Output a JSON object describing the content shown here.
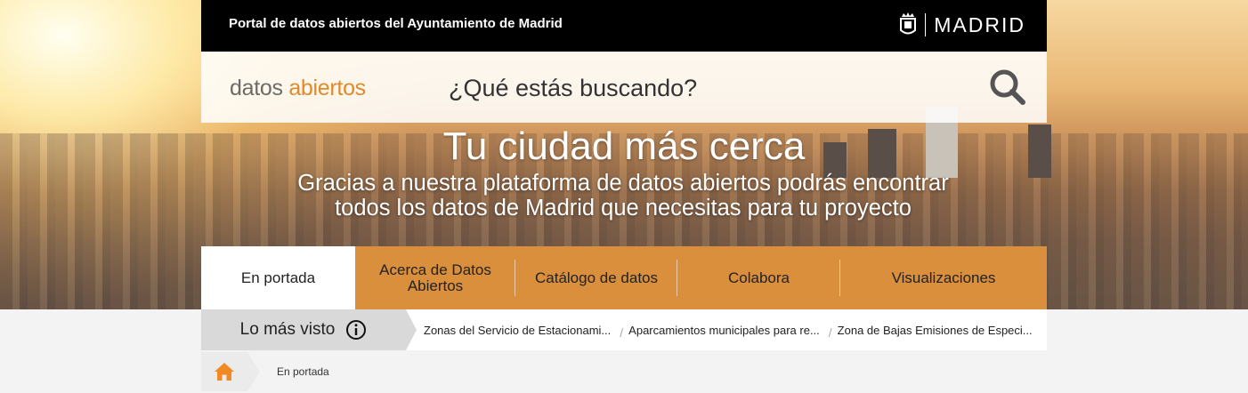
{
  "header": {
    "portal_title": "Portal de datos abiertos del Ayuntamiento de Madrid",
    "brand": "MADRID"
  },
  "search": {
    "logo_part1": "datos",
    "logo_part2": "abiertos",
    "placeholder": "¿Qué estás buscando?",
    "icon": "search-icon"
  },
  "hero": {
    "title": "Tu ciudad más cerca",
    "subtitle": "Gracias a nuestra plataforma de datos abiertos podrás encontrar todos los datos de Madrid que necesitas para tu proyecto"
  },
  "nav": {
    "items": [
      {
        "label": "En portada"
      },
      {
        "label": "Acerca de Datos Abiertos"
      },
      {
        "label": "Catálogo de datos"
      },
      {
        "label": "Colabora"
      },
      {
        "label": "Visualizaciones"
      }
    ]
  },
  "popular": {
    "label": "Lo más visto",
    "links": [
      "Zonas del Servicio de Estacionami...",
      "Aparcamientos municipales para re...",
      "Zona de Bajas Emisiones de Especi..."
    ]
  },
  "breadcrumb": {
    "current": "En portada"
  },
  "colors": {
    "accent": "#d98f3c",
    "logo_orange": "#e08a2c",
    "topbar": "#000000",
    "home_icon": "#f08a24"
  }
}
